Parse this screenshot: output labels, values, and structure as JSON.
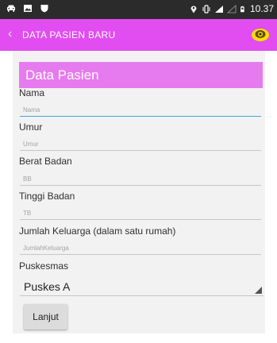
{
  "status_bar": {
    "time": "10.37",
    "left_icons": [
      "car-icon",
      "gallery-icon",
      "shield-notification-icon"
    ],
    "right_icons": [
      "location-icon",
      "vibrate-icon",
      "signal-icon",
      "signal-empty-icon",
      "battery-icon"
    ]
  },
  "app_bar": {
    "title": "DATA PASIEN BARU",
    "back_icon": "chevron-left-icon",
    "action_icon": "camera-lens-icon"
  },
  "section": {
    "title": "Data Pasien"
  },
  "form": {
    "nama": {
      "label": "Nama",
      "placeholder": "Nama"
    },
    "umur": {
      "label": "Umur",
      "placeholder": "Umur"
    },
    "berat_badan": {
      "label": "Berat Badan",
      "placeholder": "BB"
    },
    "tinggi_badan": {
      "label": "Tinggi Badan",
      "placeholder": "TB"
    },
    "jumlah_keluarga": {
      "label": "Jumlah Keluarga (dalam satu rumah)",
      "placeholder": "JumlahKeluarga"
    },
    "puskesmas": {
      "label": "Puskesmas",
      "selected": "Puskes A"
    }
  },
  "buttons": {
    "next_label": "Lanjut"
  },
  "colors": {
    "app_bar": "#e14df0",
    "section_header": "#e67aef",
    "status_bar": "#2b2b2b",
    "focus": "#3fa9d6"
  }
}
